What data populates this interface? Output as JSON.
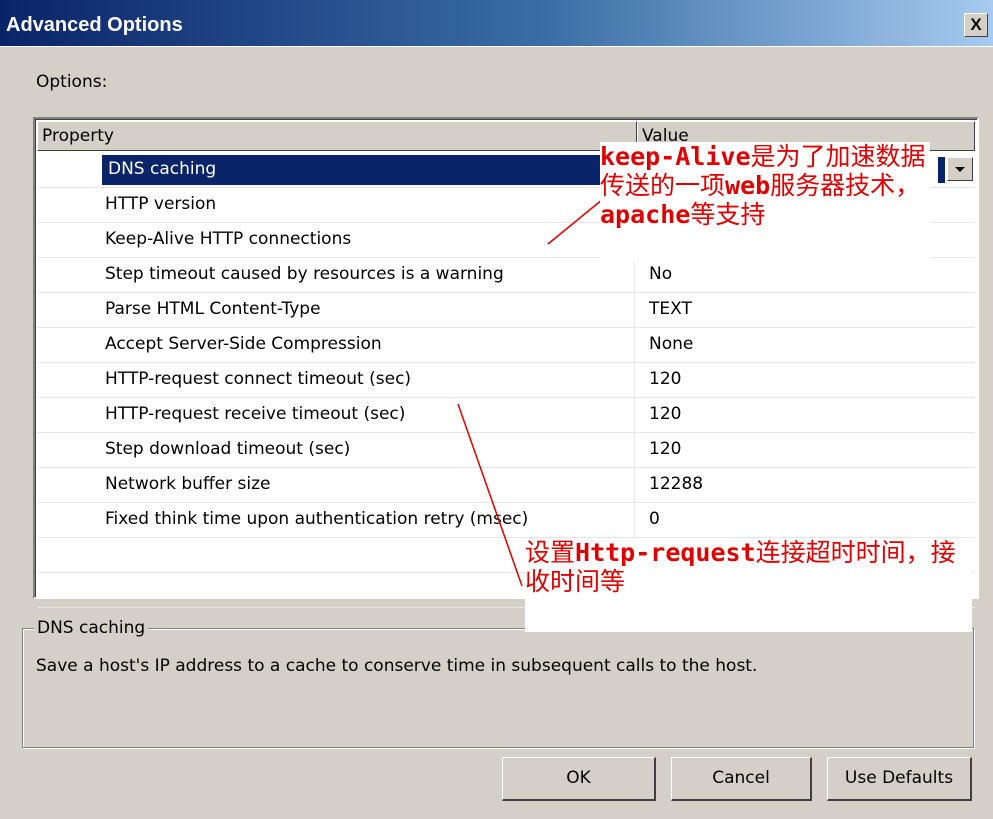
{
  "window": {
    "title": "Advanced Options",
    "close_glyph": "X"
  },
  "options_label": "Options:",
  "table": {
    "columns": [
      "Property",
      "Value"
    ],
    "rows": [
      {
        "property": "DNS caching",
        "value": "",
        "selected": true
      },
      {
        "property": "HTTP version",
        "value": ""
      },
      {
        "property": "Keep-Alive HTTP connections",
        "value": ""
      },
      {
        "property": "Step timeout caused by resources is a warning",
        "value": "No"
      },
      {
        "property": "Parse HTML Content-Type",
        "value": "TEXT"
      },
      {
        "property": "Accept Server-Side Compression",
        "value": "None"
      },
      {
        "property": "HTTP-request connect timeout (sec)",
        "value": "120"
      },
      {
        "property": "HTTP-request receive timeout (sec)",
        "value": "120"
      },
      {
        "property": "Step download timeout (sec)",
        "value": "120"
      },
      {
        "property": "Network buffer size",
        "value": "12288"
      },
      {
        "property": "Fixed think time upon authentication retry (msec)",
        "value": "0"
      },
      {
        "property": "",
        "value": ""
      },
      {
        "property": "",
        "value": ""
      }
    ]
  },
  "description": {
    "title": "DNS caching",
    "text": "Save a host's IP address to a cache to conserve time in subsequent calls to the host."
  },
  "buttons": {
    "ok": "OK",
    "cancel": "Cancel",
    "defaults": "Use Defaults"
  },
  "annotations": {
    "note1": {
      "parts": [
        {
          "text": "keep-Alive",
          "bold": true
        },
        {
          "text": "是为了加速数据传送的一项"
        },
        {
          "text": "web",
          "bold": true
        },
        {
          "text": "服务器技术，"
        },
        {
          "text": "apache",
          "bold": true
        },
        {
          "text": "等支持"
        }
      ]
    },
    "note2": {
      "parts": [
        {
          "text": "设置"
        },
        {
          "text": "Http-request",
          "bold": true
        },
        {
          "text": "连接超时时间，接收时间等"
        }
      ]
    },
    "color": "#e00000"
  },
  "colors": {
    "selection": "#0a246a",
    "face": "#d4d0c8"
  }
}
